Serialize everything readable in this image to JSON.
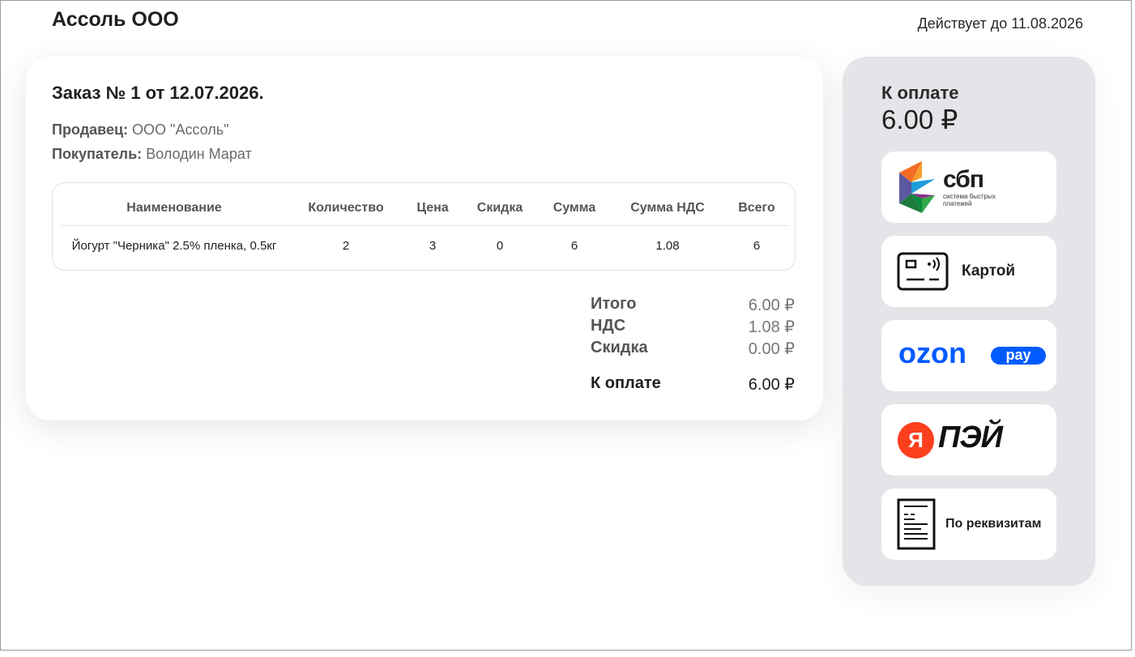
{
  "header": {
    "company": "Ассоль ООО",
    "valid_until": "Действует до 11.08.2026"
  },
  "order": {
    "title": "Заказ № 1 от 12.07.2026.",
    "seller_label": "Продавец:",
    "seller_value": "ООО \"Ассоль\"",
    "buyer_label": "Покупатель:",
    "buyer_value": "Володин Марат"
  },
  "table": {
    "headers": [
      "Наименование",
      "Количество",
      "Цена",
      "Скидка",
      "Сумма",
      "Сумма НДС",
      "Всего"
    ],
    "rows": [
      [
        "Йогурт \"Черника\" 2.5% пленка, 0.5кг",
        "2",
        "3",
        "0",
        "6",
        "1.08",
        "6"
      ]
    ]
  },
  "totals": {
    "subtotal_label": "Итого",
    "subtotal_value": "6.00 ₽",
    "vat_label": "НДС",
    "vat_value": "1.08 ₽",
    "discount_label": "Скидка",
    "discount_value": "0.00 ₽",
    "due_label": "К оплате",
    "due_value": "6.00 ₽"
  },
  "payment": {
    "label": "К оплате",
    "amount": "6.00 ₽",
    "sbp_logo": "сбп",
    "sbp_tagline_1": "система быстрых",
    "sbp_tagline_2": "платежей",
    "card_label": "Картой",
    "ozon_logo": "ozon",
    "ozon_pay": "pay",
    "yandex_letter": "Я",
    "yandex_pay": "ПЭЙ",
    "requisites_label": "По реквизитам"
  },
  "colors": {
    "side_bg": "#e4e5e8",
    "ozon_blue": "#005bff",
    "yandex_red": "#fc3f1d"
  }
}
